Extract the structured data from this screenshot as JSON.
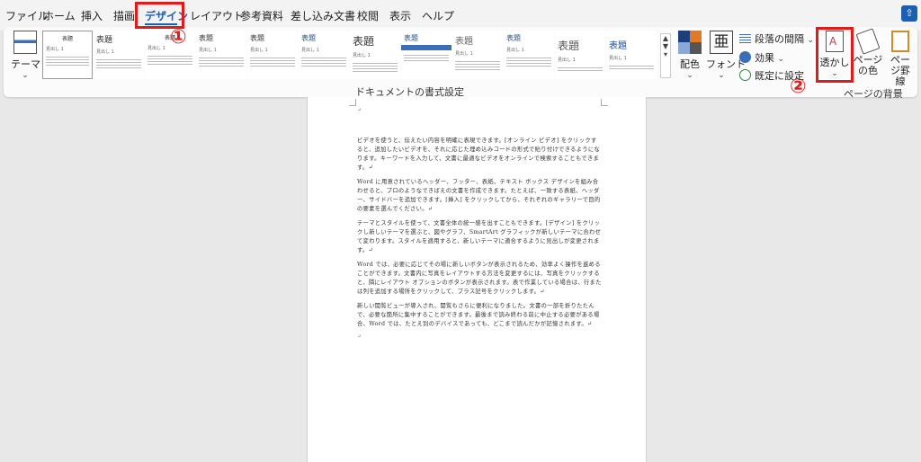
{
  "menu": {
    "items": [
      "ファイル",
      "ホーム",
      "挿入",
      "描画",
      "デザイン",
      "レイアウト",
      "参考資料",
      "差し込み文書",
      "校閲",
      "表示",
      "ヘルプ"
    ],
    "active": "デザイン"
  },
  "annotations": {
    "step1": "①",
    "step2": "②",
    "highlight_color": "#e01b1b"
  },
  "ribbon": {
    "theme_label": "テーマ",
    "gallery_group_label": "ドキュメントの書式設定",
    "gallery": [
      {
        "title": "表題",
        "sub": "見出し 1"
      },
      {
        "title": "表題",
        "sub": "見出し 1"
      },
      {
        "title": "表題",
        "sub": "見出し 1"
      },
      {
        "title": "表題",
        "sub": "見出し 1"
      },
      {
        "title": "表題",
        "sub": "見出し 1"
      },
      {
        "title": "表題",
        "sub": "見出し 1"
      },
      {
        "title": "表題",
        "sub": "見出し 1"
      },
      {
        "title": "表題",
        "sub": "見出し 1"
      },
      {
        "title": "表題",
        "sub": "見出し 1"
      },
      {
        "title": "表題",
        "sub": "見出し 1"
      },
      {
        "title": "表題",
        "sub": "見出し 1"
      },
      {
        "title": "表題",
        "sub": "見出し 1"
      }
    ],
    "colors_label": "配色",
    "fonts_label": "フォント",
    "paragraph_spacing_label": "段落の間隔",
    "effects_label": "効果",
    "set_default_label": "既定に設定",
    "watermark_label": "透かし",
    "page_color_label": "ページの色",
    "page_border_label": "ページ罫線",
    "page_bg_group_label": "ページの背景",
    "accent_color": "#1b5fb3"
  },
  "document": {
    "paragraphs": [
      "ビデオを使うと、伝えたい内容を明確に表現できます。[オンライン ビデオ] をクリックすると、追加したいビデオを、それに応じた埋め込みコードの形式で貼り付けできるようになります。キーワードを入力して、文書に最適なビデオをオンラインで検索することもできます。↵",
      "Word に用意されているヘッダー、フッター、表紙、テキスト ボックス デザインを組み合わせると、プロのようなできばえの文書を作成できます。たとえば、一致する表紙、ヘッダー、サイドバーを追加できます。[挿入] をクリックしてから、それぞれのギャラリーで目的の要素を選んでください。↵",
      "テーマとスタイルを使って、文書全体の統一感を出すこともできます。[デザイン] をクリックし新しいテーマを選ぶと、図やグラフ、SmartArt グラフィックが新しいテーマに合わせて変わります。スタイルを適用すると、新しいテーマに適合するように見出しが変更されます。↵",
      "Word では、必要に応じてその場に新しいボタンが表示されるため、効率よく操作を進めることができます。文書内に写真をレイアウトする方法を変更するには、写真をクリックすると、隣にレイアウト オプションのボタンが表示されます。表で作業している場合は、行または列を追加する場所をクリックして、プラス記号をクリックします。↵",
      "新しい閲覧ビューが導入され、閲覧もさらに便利になりました。文書の一部を折りたたんで、必要な箇所に集中することができます。最後まで読み終わる前に中止する必要がある場合、Word では、たとえ別のデバイスであっても、どこまで読んだかが記憶されます。↵"
    ],
    "mark_top": "↵",
    "mark_end": "↵"
  }
}
